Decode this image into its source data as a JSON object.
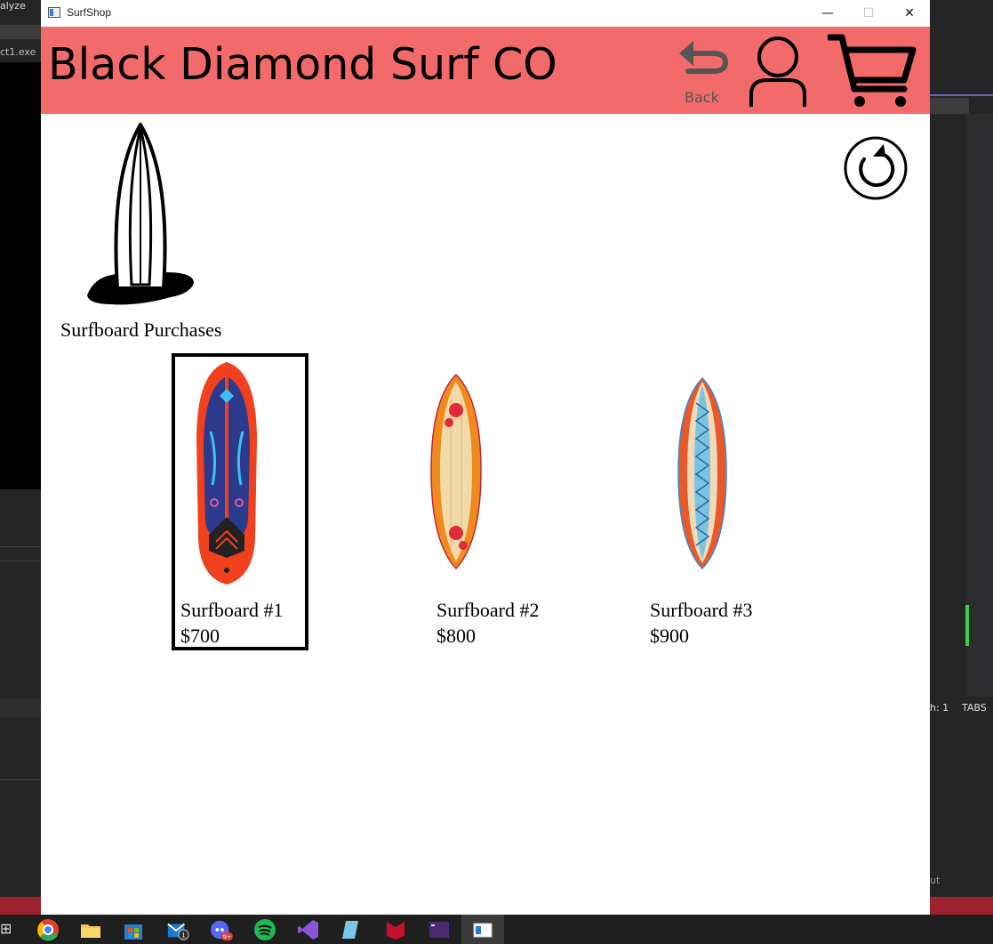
{
  "window": {
    "title": "SurfShop",
    "controls": {
      "minimize": "—",
      "maximize": "☐",
      "close": "✕"
    }
  },
  "header": {
    "brand": "Black Diamond Surf CO",
    "back_label": "Back",
    "bg_color": "#f26a6a"
  },
  "section": {
    "title": "Surfboard Purchases"
  },
  "products": [
    {
      "name": "Surfboard #1",
      "price": "$700",
      "selected": true
    },
    {
      "name": "Surfboard #2",
      "price": "$800",
      "selected": false
    },
    {
      "name": "Surfboard #3",
      "price": "$900",
      "selected": false
    }
  ],
  "background": {
    "left_menu": "alyze",
    "left_tab": "ct1.exe",
    "right_status_line": "h: 1",
    "right_status_tabs": "TABS",
    "right_output": "ut"
  },
  "taskbar": {
    "apps": [
      "chrome-icon",
      "file-explorer-icon",
      "store-icon",
      "mail-icon",
      "discord-icon",
      "spotify-icon",
      "visual-studio-icon",
      "notepad-icon",
      "mcafee-icon",
      "terminal-icon",
      "surfshop-app-icon"
    ],
    "mail_badge": "1",
    "discord_badge": "9+"
  }
}
